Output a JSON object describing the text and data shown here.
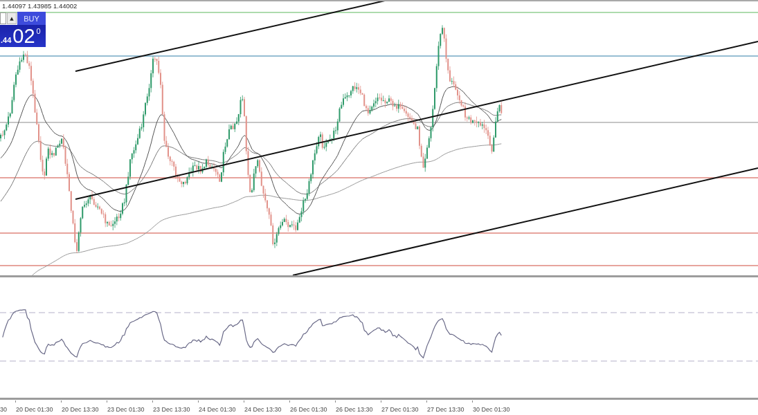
{
  "chart_header": {
    "ohlc": "1.44097 1.43985 1.44002"
  },
  "trade_panel": {
    "increase_button": "▲",
    "buy_label": "BUY",
    "price": {
      "prefix": ".44",
      "big": "02",
      "fraction": "0"
    }
  },
  "time_axis": {
    "labels": [
      "30",
      "20 Dec 01:30",
      "20 Dec 13:30",
      "23 Dec 01:30",
      "23 Dec 13:30",
      "24 Dec 01:30",
      "24 Dec 13:30",
      "26 Dec 01:30",
      "26 Dec 13:30",
      "27 Dec 01:30",
      "27 Dec 13:30",
      "30 Dec 01:30"
    ]
  }
}
